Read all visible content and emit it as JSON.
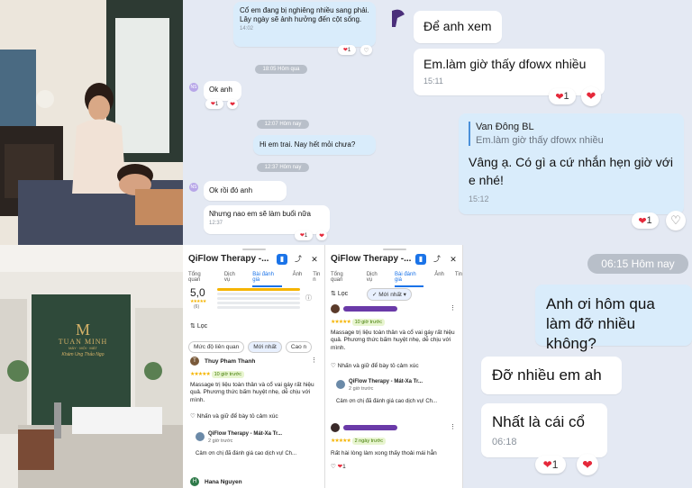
{
  "spa_photo_1": {
    "description_icon": "therapist-massage-photo"
  },
  "spa_photo_2": {
    "logo_name": "TUAN MINH",
    "logo_sub": "MÁY · MÓI · MẮT",
    "logo_script": "Khám Ung Thảo Ngọ"
  },
  "chat_top_mid": {
    "msg1": "Cổ em đang bị nghiêng nhiều sang phải. Lây ngày sẽ ảnh hưởng đến cột sống.",
    "msg1_time": "14:02",
    "msg1_react": "1",
    "date1": "18:05 Hôm qua",
    "msg2": "Ok anh",
    "msg2_react": "1",
    "date2": "12:07 Hôm nay",
    "msg3": "Hi em trai. Nay hết mỏi chưa?",
    "date3": "12:37 Hôm nay",
    "msg4": "Ok rồi đó anh",
    "msg5": "Nhưng nao em sẽ làm buổi nữa",
    "msg5_time": "12:37",
    "msg5_react": "1",
    "avatar_initials": "NS"
  },
  "chat_top_right": {
    "msg1": "Để anh xem",
    "msg2": "Em.làm giờ thấy dfowx nhiều",
    "msg2_time": "15:11",
    "msg2_react": "1",
    "quote_name": "Van Đông BL",
    "quote_text": "Em.làm giờ thấy dfowx nhiều",
    "msg3": "Vâng ạ. Có gì a cứ nhắn hẹn giờ với e nhé!",
    "msg3_time": "15:12",
    "msg3_react": "1"
  },
  "review_left": {
    "title": "QiFlow Therapy -...",
    "tabs": [
      "Tổng quan",
      "Dịch vụ",
      "Bài đánh giá",
      "Ảnh",
      "Tin n"
    ],
    "rating": "5,0",
    "count": "(6)",
    "filter_label": "Lọc",
    "chips": [
      "Mức độ liên quan",
      "Mới nhất",
      "Cao n"
    ],
    "r1_name": "Thuy Pham Thanh",
    "r1_badge": "10 giờ trước",
    "r1_text": "Massage trị liệu toàn thân và cổ vai gáy rất hiệu quả. Phương thức bấm huyệt nhẹ, dễ chịu với mình.",
    "r1_react": "Nhấn và giữ để bày tỏ cảm xúc",
    "owner_name": "QiFlow Therapy - Mát-Xa Tr...",
    "owner_time": "2 giờ trước",
    "owner_text": "Cảm ơn chị đã đánh giá cao dịch vụ! Ch...",
    "r2_name": "Hana Nguyen"
  },
  "review_right": {
    "title": "QiFlow Therapy -...",
    "tabs": [
      "Tổng quan",
      "Dịch vụ",
      "Bài đánh giá",
      "Ảnh",
      "Tin"
    ],
    "filter_label": "Lọc",
    "chip": "Mới nhất",
    "r1_badge": "10 giờ trước",
    "r1_text": "Massage trị liệu toàn thân và cổ vai gáy rất hiệu quả. Phương thức bấm huyệt nhẹ, dễ chịu với mình.",
    "r1_react": "Nhấn và giữ để bày tỏ cảm xúc",
    "owner_name": "QiFlow Therapy - Mát-Xa Tr...",
    "owner_time": "2 giờ trước",
    "owner_text": "Cảm ơn chị đã đánh giá cao dịch vụ! Ch...",
    "r2_badge": "2 ngày trước",
    "r2_text": "Rất hài lòng làm xong thấy thoải mái hẳn",
    "r2_react": "1"
  },
  "chat_bottom_right": {
    "date": "06:15 Hôm nay",
    "msg1": "Anh ơi hôm qua làm đỡ nhiều không?",
    "msg2": "Đỡ nhiều em ah",
    "msg3": "Nhất là cái cổ",
    "msg3_time": "06:18",
    "msg3_react": "1"
  },
  "colors": {
    "chat_bg": "#e4e9f3",
    "my_bubble": "#d9ecfb",
    "heart": "#e5283a",
    "accent_blue": "#1a73e8",
    "star": "#f5b400"
  }
}
